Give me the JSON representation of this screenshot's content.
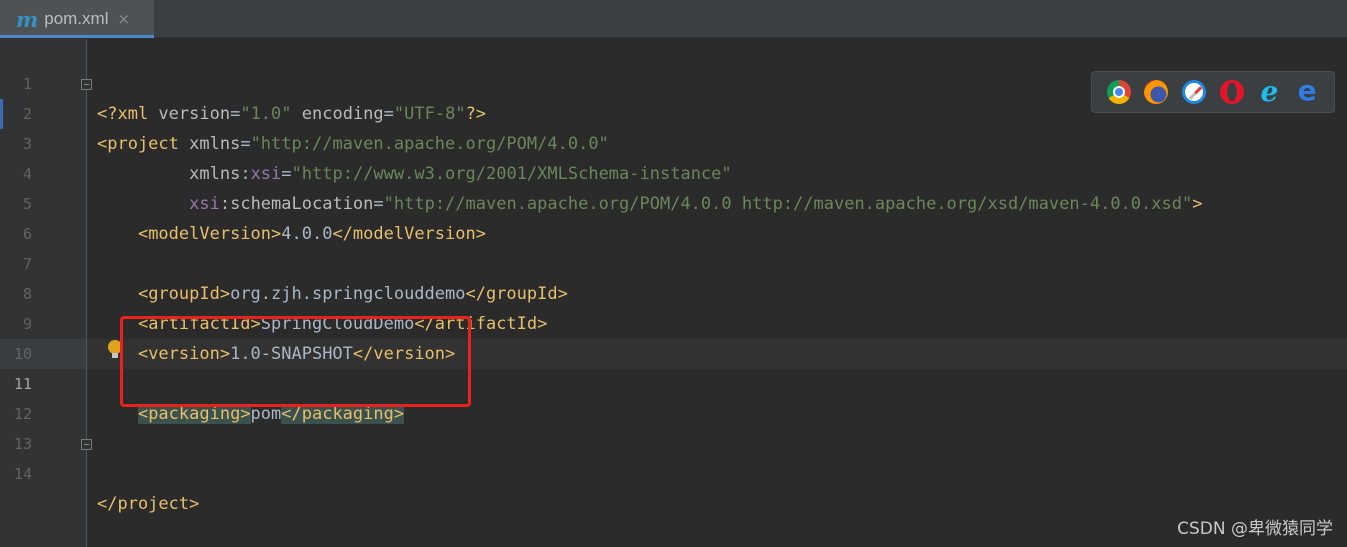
{
  "tab": {
    "icon": "maven-m-icon",
    "icon_glyph": "m",
    "label": "pom.xml",
    "close_glyph": "×"
  },
  "colors": {
    "tag": "#e8bf6a",
    "attribute": "#bababa",
    "value": "#6a8759",
    "namespace": "#9876aa",
    "text": "#a9b7c6",
    "highlight_box": "#e8231b",
    "tab_accent": "#4a88c7"
  },
  "line_numbers": [
    "1",
    "2",
    "3",
    "4",
    "5",
    "6",
    "7",
    "8",
    "9",
    "10",
    "11",
    "12",
    "13",
    "14"
  ],
  "code": {
    "l1": {
      "open": "<?xml ",
      "a1": "version",
      "eq1": "=",
      "v1": "\"1.0\"",
      "sp": " ",
      "a2": "encoding",
      "eq2": "=",
      "v2": "\"UTF-8\"",
      "close": "?>"
    },
    "l2": {
      "open": "<project ",
      "a1": "xmlns",
      "eq": "=",
      "v1": "\"http://maven.apache.org/POM/4.0.0\""
    },
    "l3": {
      "indent": "         ",
      "a1": "xmlns",
      "colon": ":",
      "ns": "xsi",
      "eq": "=",
      "v1": "\"http://www.w3.org/2001/XMLSchema-instance\""
    },
    "l4": {
      "indent": "         ",
      "ns": "xsi",
      "colon": ":",
      "a1": "schemaLocation",
      "eq": "=",
      "v1": "\"http://maven.apache.org/POM/4.0.0 http://maven.apache.org/xsd/maven-4.0.0.xsd\"",
      "close": ">"
    },
    "l5": {
      "indent": "    ",
      "open": "<modelVersion>",
      "text": "4.0.0",
      "close": "</modelVersion>"
    },
    "l7": {
      "indent": "    ",
      "open": "<groupId>",
      "text": "org.zjh.springclouddemo",
      "close": "</groupId>"
    },
    "l8": {
      "indent": "    ",
      "open": "<artifactId>",
      "text": "SpringCloudDemo",
      "close": "</artifactId>"
    },
    "l9": {
      "indent": "    ",
      "open": "<version>",
      "text": "1.0-SNAPSHOT",
      "close": "</version>"
    },
    "l11": {
      "indent": "    ",
      "open": "<packaging>",
      "text": "pom",
      "close": "</packaging>"
    },
    "l14": {
      "close": "</project>"
    }
  },
  "browsers": [
    "chrome-icon",
    "firefox-icon",
    "safari-icon",
    "opera-icon",
    "ie-icon",
    "edge-icon"
  ],
  "browser_glyphs": {
    "ie": "e",
    "edge": "e"
  },
  "watermark": "CSDN @卑微猿同学"
}
